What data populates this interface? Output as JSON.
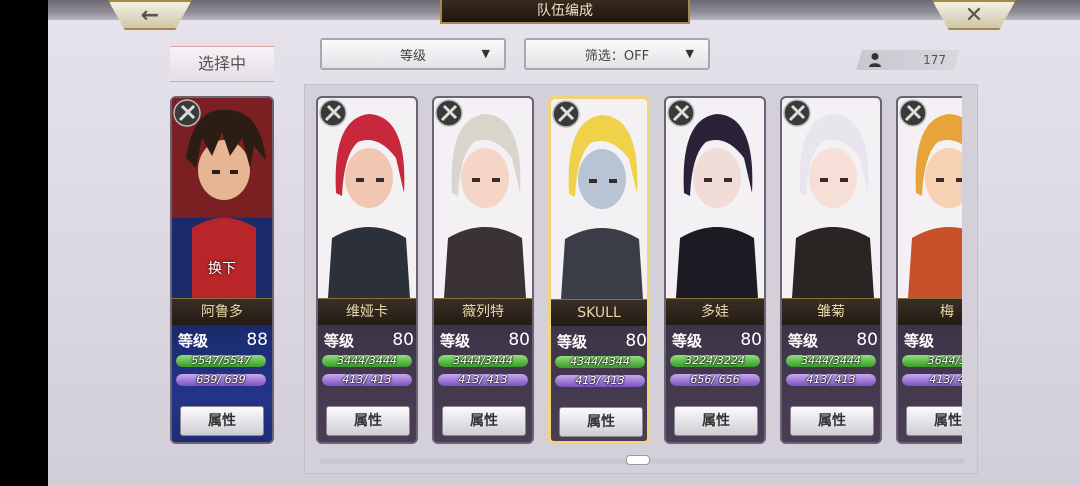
{
  "header": {
    "title": "队伍编成",
    "back_icon": "←",
    "close_icon": "✕"
  },
  "selected_label": "选择中",
  "sort_dropdown": {
    "value": "等级",
    "arrow": "▼"
  },
  "filter_dropdown": {
    "value": "筛选：OFF",
    "arrow": "▼"
  },
  "player_count": "177",
  "current_member": {
    "name": "阿鲁多",
    "level_label": "等级",
    "level": "88",
    "hp_text": "5547/5547",
    "hp_fraction": 1.0,
    "mp_text": "639/ 639",
    "mp_fraction": 1.0,
    "swap_label": "换下",
    "attr_label": "属性"
  },
  "characters": [
    {
      "name": "维娅卡",
      "level_label": "等级",
      "level": "80",
      "hp_text": "3444/3444",
      "hp_fraction": 1.0,
      "mp_text": "413/ 413",
      "mp_fraction": 1.0,
      "attr_label": "属性",
      "selected": false,
      "hair": "#c8283c",
      "skin": "#f1c7b4",
      "outfit": "#2c3038"
    },
    {
      "name": "薇列特",
      "level_label": "等级",
      "level": "80",
      "hp_text": "3444/3444",
      "hp_fraction": 1.0,
      "mp_text": "413/ 413",
      "mp_fraction": 1.0,
      "attr_label": "属性",
      "selected": false,
      "hair": "#d9d5cc",
      "skin": "#f4d5c6",
      "outfit": "#3a3234"
    },
    {
      "name": "SKULL",
      "level_label": "等级",
      "level": "80",
      "hp_text": "4344/4344",
      "hp_fraction": 1.0,
      "mp_text": "413/ 413",
      "mp_fraction": 1.0,
      "attr_label": "属性",
      "selected": true,
      "hair": "#f0d24a",
      "skin": "#b8c4d4",
      "outfit": "#3a3d46"
    },
    {
      "name": "多娃",
      "level_label": "等级",
      "level": "80",
      "hp_text": "3224/3224",
      "hp_fraction": 1.0,
      "mp_text": "656/ 656",
      "mp_fraction": 1.0,
      "attr_label": "属性",
      "selected": false,
      "hair": "#2a2238",
      "skin": "#f2dcd8",
      "outfit": "#1c1a22"
    },
    {
      "name": "雏菊",
      "level_label": "等级",
      "level": "80",
      "hp_text": "3444/3444",
      "hp_fraction": 1.0,
      "mp_text": "413/ 413",
      "mp_fraction": 1.0,
      "attr_label": "属性",
      "selected": false,
      "hair": "#e9e5ee",
      "skin": "#f6dfd6",
      "outfit": "#2a2422"
    },
    {
      "name": "梅",
      "level_label": "等级",
      "level": "80",
      "hp_text": "3644/3",
      "hp_fraction": 1.0,
      "mp_text": "413/ 4",
      "mp_fraction": 1.0,
      "attr_label": "属性",
      "selected": false,
      "hair": "#e8a43a",
      "skin": "#f6d2b2",
      "outfit": "#c8502a"
    }
  ]
}
